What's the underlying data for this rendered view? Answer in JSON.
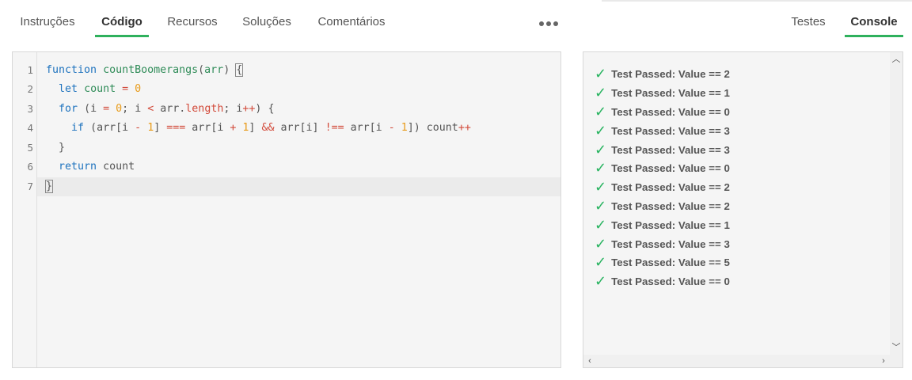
{
  "left_tabs": [
    {
      "label": "Instruções"
    },
    {
      "label": "Código",
      "active": true
    },
    {
      "label": "Recursos"
    },
    {
      "label": "Soluções"
    },
    {
      "label": "Comentários"
    }
  ],
  "right_tabs": [
    {
      "label": "Testes"
    },
    {
      "label": "Console",
      "active": true
    }
  ],
  "more_icon": "more-horizontal-icon",
  "accent_color": "#2fb15d",
  "editor": {
    "line_numbers": [
      "1",
      "2",
      "3",
      "4",
      "5",
      "6",
      "7"
    ],
    "lines": [
      "function countBoomerangs(arr) {",
      "  let count = 0",
      "  for (i = 0; i < arr.length; i++) {",
      "    if (arr[i - 1] === arr[i + 1] && arr[i] !== arr[i - 1]) count++",
      "  }",
      "  return count",
      "}"
    ]
  },
  "console": {
    "check_icon": "check-icon",
    "results": [
      "Test Passed: Value == 2",
      "Test Passed: Value == 1",
      "Test Passed: Value == 0",
      "Test Passed: Value == 3",
      "Test Passed: Value == 3",
      "Test Passed: Value == 0",
      "Test Passed: Value == 2",
      "Test Passed: Value == 2",
      "Test Passed: Value == 1",
      "Test Passed: Value == 3",
      "Test Passed: Value == 5",
      "Test Passed: Value == 0"
    ]
  }
}
